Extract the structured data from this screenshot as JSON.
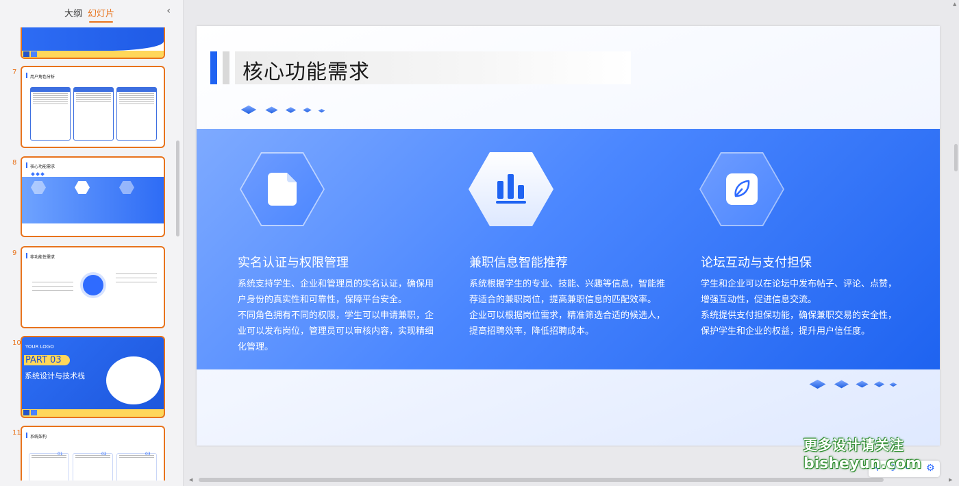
{
  "panel": {
    "tab_outline": "大纲",
    "tab_slides": "幻灯片",
    "collapse_icon": "chevron-left-icon"
  },
  "thumbnails": [
    {
      "number": "7",
      "title": "用户角色分析",
      "cols": [
        "学生角色",
        "企业角色",
        "管理员角色"
      ]
    },
    {
      "number": "8",
      "title": "核心功能需求"
    },
    {
      "number": "9",
      "title": "非功能性需求"
    },
    {
      "number": "10",
      "logo": "YOUR LOGO",
      "part": "PART 03",
      "subtitle": "系统设计与技术栈"
    },
    {
      "number": "11",
      "title": "系统架构",
      "nums": [
        "01",
        "02",
        "03"
      ]
    }
  ],
  "slide": {
    "title": "核心功能需求",
    "columns": [
      {
        "icon": "document-icon",
        "title": "实名认证与权限管理",
        "text": "系统支持学生、企业和管理员的实名认证，确保用户身份的真实性和可靠性，保障平台安全。\n不同角色拥有不同的权限，学生可以申请兼职，企业可以发布岗位，管理员可以审核内容，实现精细化管理。"
      },
      {
        "icon": "bar-chart-icon",
        "title": "兼职信息智能推荐",
        "text": "系统根据学生的专业、技能、兴趣等信息，智能推荐适合的兼职岗位，提高兼职信息的匹配效率。\n企业可以根据岗位需求，精准筛选合适的候选人，提高招聘效率，降低招聘成本。"
      },
      {
        "icon": "leaf-icon",
        "title": "论坛互动与支付担保",
        "text": "学生和企业可以在论坛中发布帖子、评论、点赞，增强互动性，促进信息交流。\n系统提供支付担保功能，确保兼职交易的安全性，保护学生和企业的权益，提升用户信任度。"
      }
    ]
  },
  "watermark": {
    "line1": "更多设计请关注",
    "line2": "bisheyun.com"
  },
  "colors": {
    "accent": "#e8731c",
    "slide_blue": "#1f63f2",
    "band_light": "#7eaaff"
  }
}
